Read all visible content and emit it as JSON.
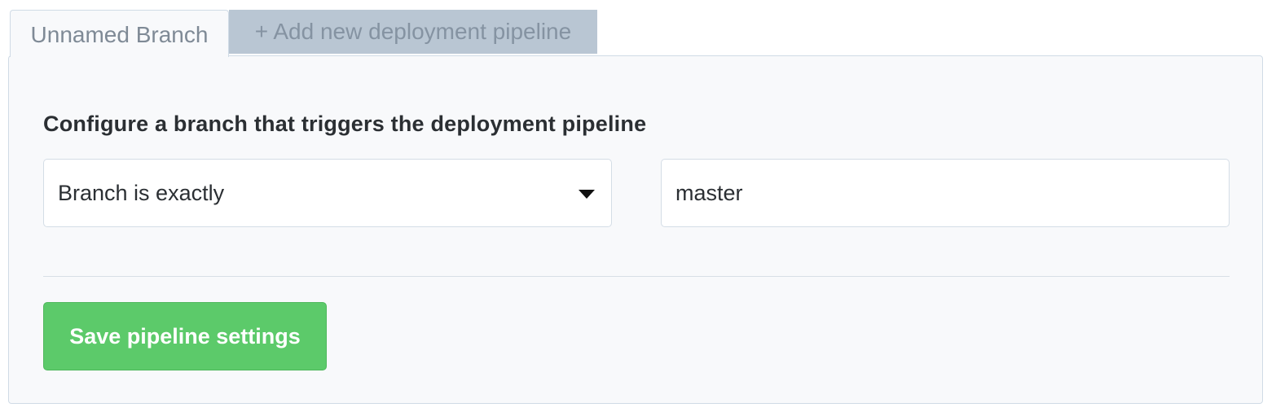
{
  "tabs": {
    "active_label": "Unnamed Branch",
    "add_label": "+ Add new deployment pipeline"
  },
  "panel": {
    "heading": "Configure a branch that triggers the deployment pipeline",
    "branch_match": {
      "selected": "Branch is exactly",
      "icon": "chevron-down-icon"
    },
    "branch_name": {
      "value": "master"
    },
    "save_label": "Save pipeline settings"
  },
  "colors": {
    "accent_green": "#5cca6a",
    "tab_inactive_bg": "#b9c6d3",
    "panel_bg": "#f8f9fb",
    "border": "#d0dbe6"
  }
}
